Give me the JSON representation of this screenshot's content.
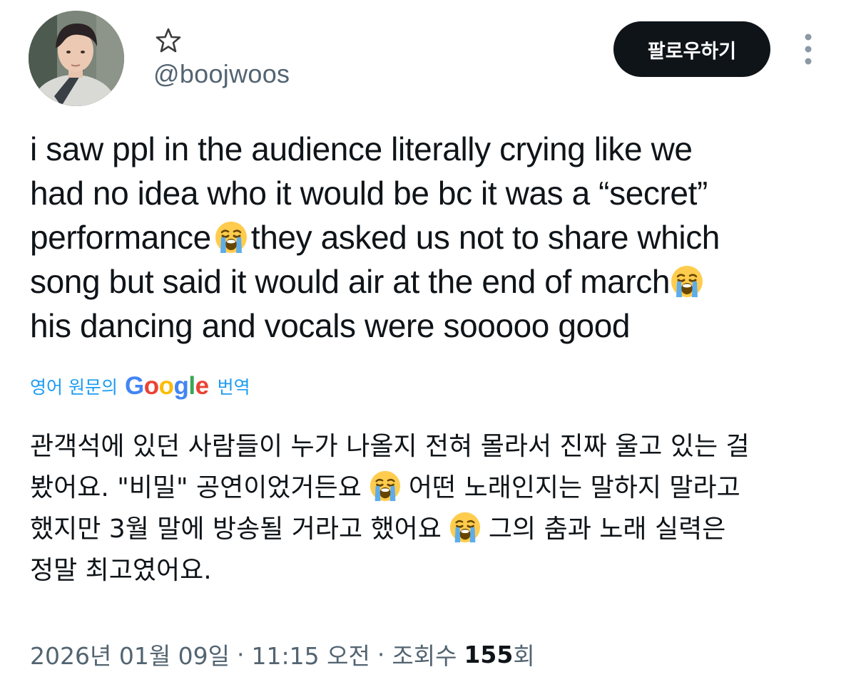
{
  "user": {
    "handle": "@boojwoos"
  },
  "follow_button": {
    "label": "팔로우하기"
  },
  "tweet": {
    "lines": [
      {
        "text": "i saw ppl in the audience literally crying like we"
      },
      {
        "text": "had no idea who it would be bc it was a “secret”"
      },
      {
        "before": "performance",
        "after": "they asked us not to share which"
      },
      {
        "before": "song but said it would air at the end of march",
        "after": ""
      },
      {
        "text": "his dancing and vocals were sooooo good"
      }
    ]
  },
  "translate": {
    "prefix": "영어 원문의",
    "brand_letters": [
      "G",
      "o",
      "o",
      "g",
      "l",
      "e"
    ],
    "suffix": "번역"
  },
  "translation": {
    "lines": [
      {
        "text": "관객석에 있던 사람들이 누가 나올지 전혀 몰라서 진짜 울고 있는 걸"
      },
      {
        "before": "봤어요. \"비밀\" 공연이었거든요",
        "after": "어떤 노래인지는 말하지 말라고"
      },
      {
        "before": "했지만 3월 말에 방송될 거라고 했어요",
        "after": "그의 춤과 노래 실력은"
      },
      {
        "text": "정말 최고였어요."
      }
    ]
  },
  "meta": {
    "date": "2026년 01월 09일",
    "separator": "·",
    "time": "11:15 오전",
    "views_label": "조회수",
    "views_count": "155",
    "views_suffix": "회"
  },
  "colors": {
    "text": "#0f1419",
    "secondary": "#536471",
    "link": "#1d9bf0",
    "button_bg": "#0f1419",
    "button_text": "#ffffff"
  },
  "icons": {
    "star": "star-outline-icon",
    "more": "more-vertical-icon",
    "emoji": "loudly-crying-face-emoji"
  }
}
